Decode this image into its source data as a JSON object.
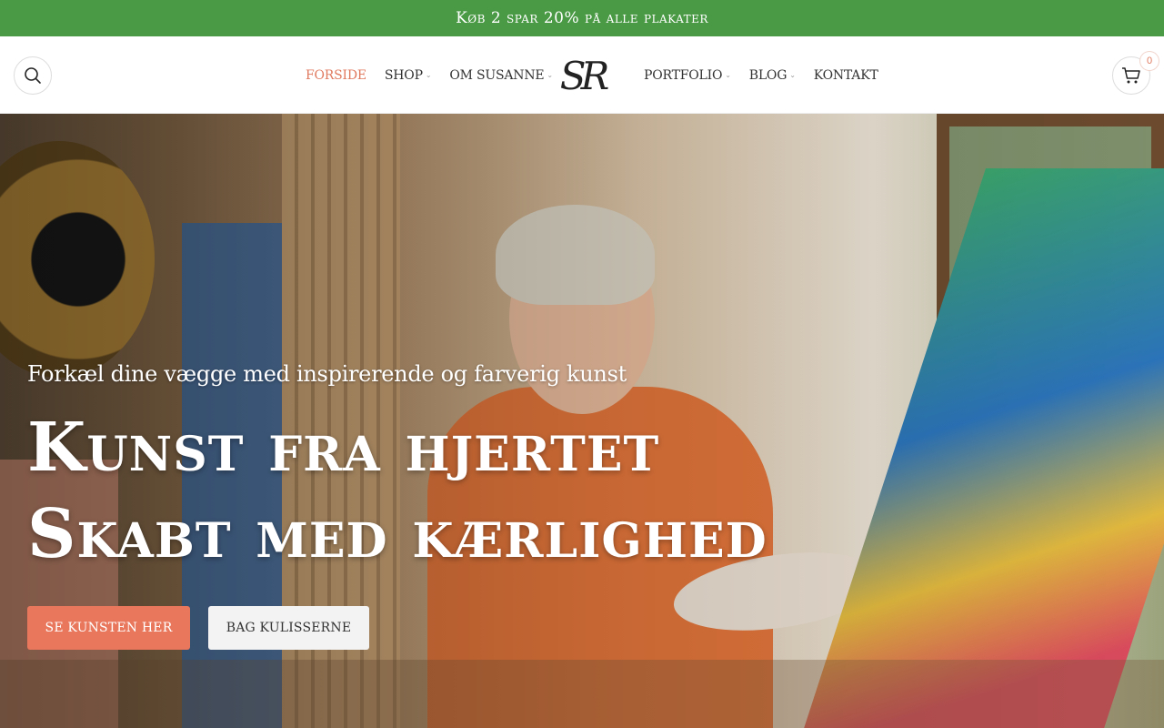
{
  "promo": {
    "text": "Køb 2 spar 20% på alle plakater"
  },
  "header": {
    "nav_left": [
      {
        "label": "FORSIDE",
        "active": true,
        "has_dropdown": false
      },
      {
        "label": "SHOP",
        "active": false,
        "has_dropdown": true
      },
      {
        "label": "OM SUSANNE",
        "active": false,
        "has_dropdown": true
      }
    ],
    "nav_right": [
      {
        "label": "PORTFOLIO",
        "has_dropdown": true
      },
      {
        "label": "BLOG",
        "has_dropdown": true
      },
      {
        "label": "KONTAKT",
        "has_dropdown": false
      }
    ],
    "logo_text": "SR",
    "cart_count": "0",
    "icons": {
      "search": "search-icon",
      "cart": "cart-icon",
      "dropdown": "chevron-down-icon"
    }
  },
  "hero": {
    "subtitle": "Forkæl dine vægge med inspirerende og farverig kunst",
    "title_line1": "Kunst fra hjertet",
    "title_line2": "Skabt med kærlighed",
    "primary_button": "SE KUNSTEN HER",
    "secondary_button": "BAG KULISSERNE"
  },
  "colors": {
    "promo_bg": "#4a9a45",
    "accent": "#e8775c",
    "active_nav": "#e07a5f"
  }
}
